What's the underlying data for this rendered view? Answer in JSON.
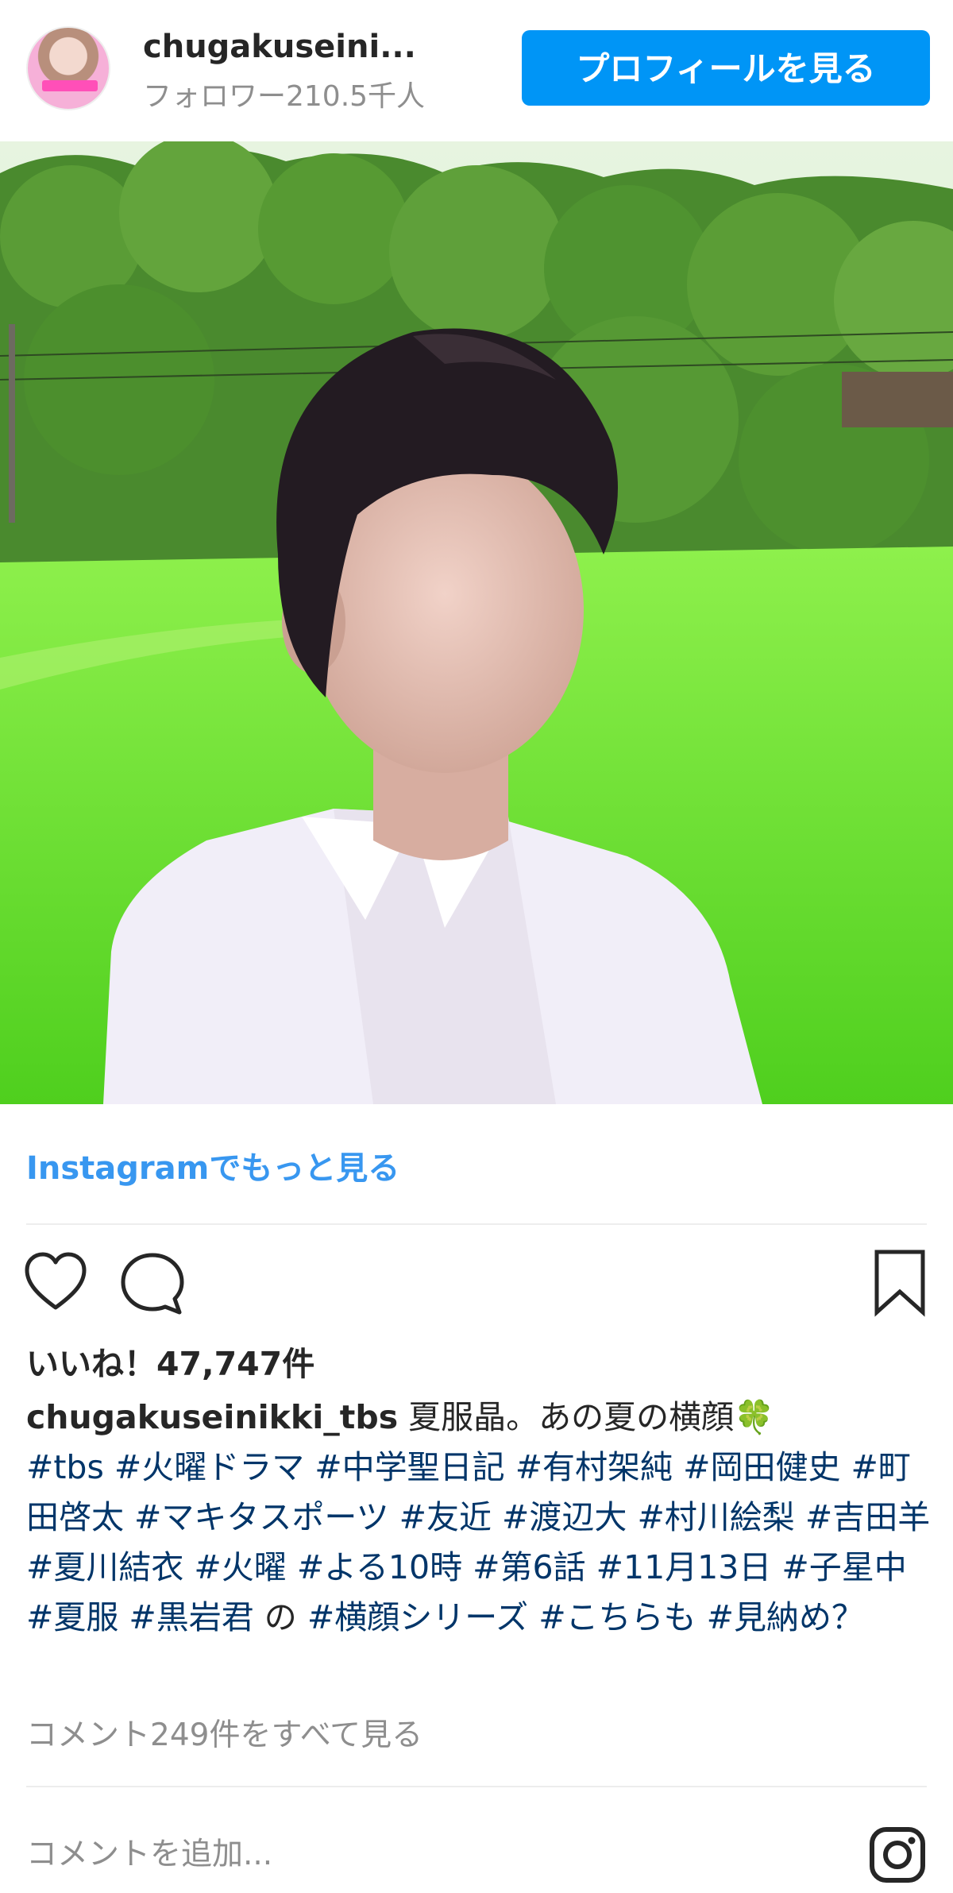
{
  "header": {
    "username": "chugakuseini...",
    "followers": "フォロワー210.5千人",
    "profile_button": "プロフィールを見る"
  },
  "post": {
    "more_link": "Instagramでもっと見る",
    "likes": "いいね！47,747件",
    "caption_user": "chugakuseinikki_tbs",
    "caption_text": " 夏服晶。あの夏の横顔",
    "caption_emoji": "🍀",
    "hashtags": [
      {
        "text": "#tbs",
        "after": " "
      },
      {
        "text": "#火曜ドラマ",
        "after": " "
      },
      {
        "text": "#中学聖日記",
        "after": " "
      },
      {
        "text": "#有村架純",
        "after": " "
      },
      {
        "text": "#岡田健史",
        "after": " "
      },
      {
        "text": "#町田啓太",
        "after": " "
      },
      {
        "text": "#マキタスポーツ",
        "after": " "
      },
      {
        "text": "#友近",
        "after": " "
      },
      {
        "text": "#渡辺大",
        "after": " "
      },
      {
        "text": "#村川絵梨",
        "after": " "
      },
      {
        "text": "#吉田羊",
        "after": " "
      },
      {
        "text": "#夏川結衣",
        "after": " "
      },
      {
        "text": "#火曜",
        "after": " "
      },
      {
        "text": "#よる10時",
        "after": " "
      },
      {
        "text": "#第6話",
        "after": " "
      },
      {
        "text": "#11月13日",
        "after": " "
      },
      {
        "text": "#子星中",
        "after": " "
      },
      {
        "text": "#夏服",
        "after": " "
      },
      {
        "text": "#黒岩君",
        "after": " の "
      },
      {
        "text": "#横顔シリーズ",
        "after": " "
      },
      {
        "text": "#こちらも",
        "after": " "
      },
      {
        "text": "#見納め？",
        "after": ""
      }
    ],
    "view_comments": "コメント249件をすべて見る",
    "comment_placeholder": "コメントを追加..."
  },
  "icons": [
    "heart-icon",
    "comment-icon",
    "bookmark-icon",
    "instagram-icon"
  ],
  "colors": {
    "accent": "#0095f6",
    "link": "#3897f0",
    "hashtag": "#003569",
    "muted": "#8e8e8e"
  }
}
